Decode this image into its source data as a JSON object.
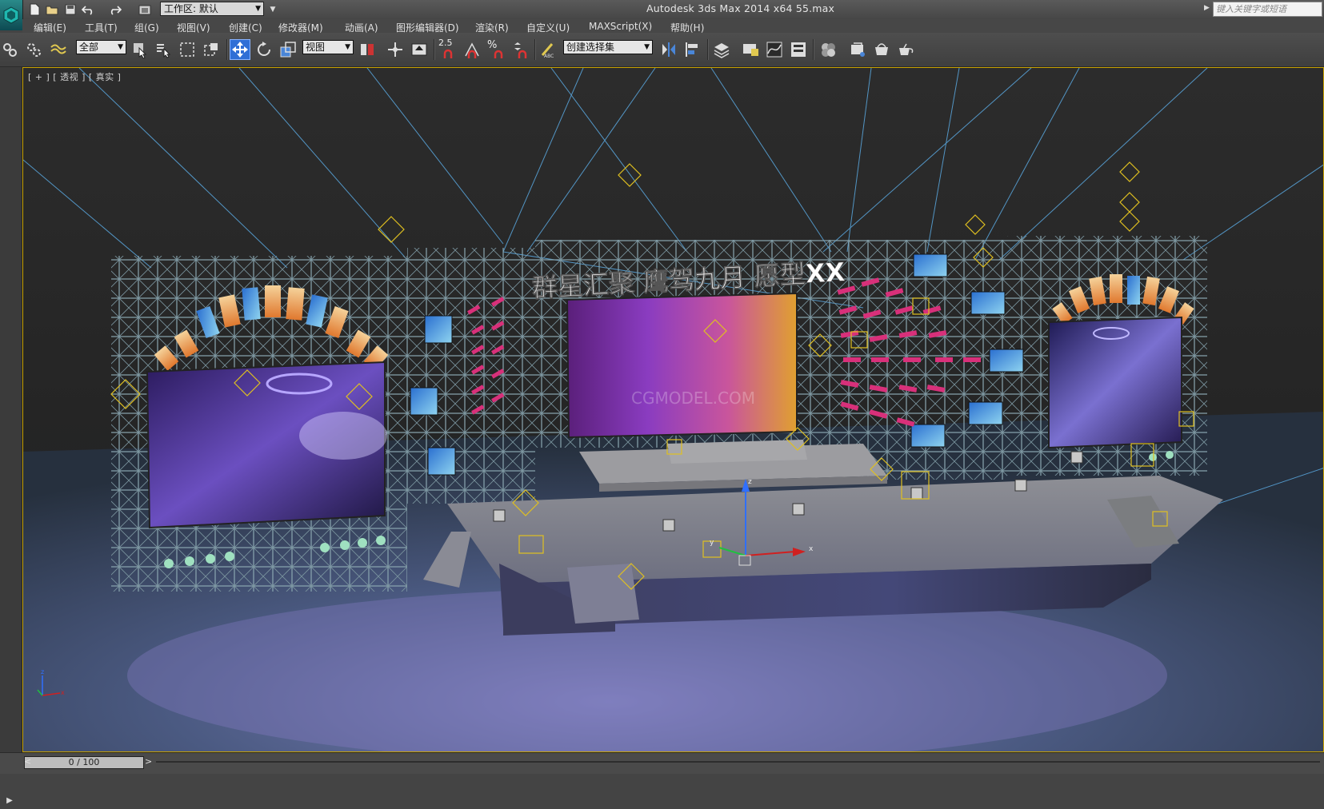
{
  "window": {
    "title": "Autodesk 3ds Max  2014 x64        55.max",
    "workspace_label": "工作区: 默认",
    "search_placeholder": "键入关键字或短语"
  },
  "menu": [
    {
      "label": "编辑(E)"
    },
    {
      "label": "工具(T)"
    },
    {
      "label": "组(G)"
    },
    {
      "label": "视图(V)"
    },
    {
      "label": "创建(C)"
    },
    {
      "label": "修改器(M)"
    },
    {
      "label": "动画(A)"
    },
    {
      "label": "图形编辑器(D)"
    },
    {
      "label": "渲染(R)"
    },
    {
      "label": "自定义(U)"
    },
    {
      "label": "MAXScript(X)"
    },
    {
      "label": "帮助(H)"
    }
  ],
  "toolbar": {
    "filter_select": "全部",
    "coord_select": "视图",
    "snap_label": "2.5",
    "named_selection": "创建选择集"
  },
  "viewport": {
    "label": "[ + ] [ 透视 ] [ 真实 ]",
    "stage_banner": "群星汇聚 鹰驾九月 愿型XX",
    "watermark": "CGMODEL.COM",
    "axis_x": "x",
    "axis_y": "y",
    "axis_z": "z"
  },
  "timeline": {
    "frame": "0 / 100",
    "prev": "<",
    "next": ">"
  },
  "colors": {
    "active_tool": "#2f6fd6",
    "viewport_border": "#c8a200",
    "light_ray": "#5aa8e0",
    "helper": "#e0c020"
  }
}
